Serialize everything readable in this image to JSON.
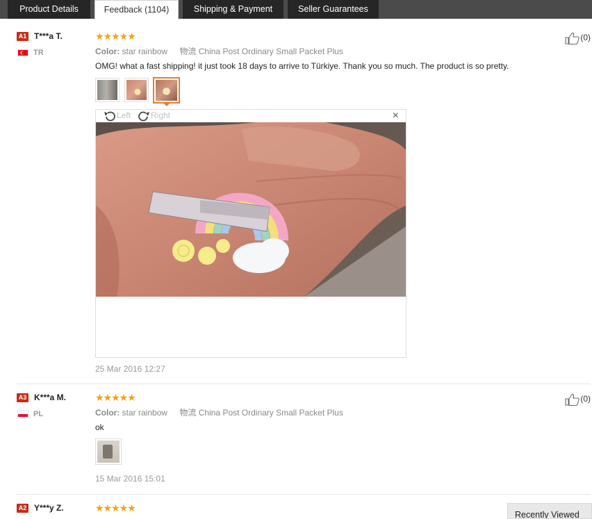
{
  "tabs": [
    {
      "label": "Product Details",
      "active": false
    },
    {
      "label": "Feedback (1104)",
      "active": true
    },
    {
      "label": "Shipping & Payment",
      "active": false
    },
    {
      "label": "Seller Guarantees",
      "active": false
    }
  ],
  "reviews": [
    {
      "badge": "A1",
      "name": "T***a T.",
      "country": "TR",
      "stars": "★★★★★",
      "color_label": "Color:",
      "color_value": "star rainbow",
      "logistics_label": "物流",
      "logistics_value": "China Post Ordinary Small Packet Plus",
      "text": "OMG! what a fast shipping! it just took 18 days to arrive to Türkiye. Thank you so much. The product is so pretty.",
      "date": "25 Mar 2016 12:27",
      "likes": "(0)"
    },
    {
      "badge": "A3",
      "name": "K***a M.",
      "country": "PL",
      "stars": "★★★★★",
      "color_label": "Color:",
      "color_value": "star rainbow",
      "logistics_label": "物流",
      "logistics_value": "China Post Ordinary Small Packet Plus",
      "text": "ok",
      "date": "15 Mar 2016 15:01",
      "likes": "(0)"
    },
    {
      "badge": "A2",
      "name": "Y***y Z.",
      "country": "",
      "stars": "★★★★★"
    }
  ],
  "viewer": {
    "left_label": "Left",
    "right_label": "Right",
    "close_label": "×"
  },
  "recently_viewed": "Recently Viewed",
  "colors": {
    "badge": "#c62d17",
    "star": "#f6a10d",
    "tab_bg": "#262626",
    "selected_thumb": "#e37f2a"
  }
}
